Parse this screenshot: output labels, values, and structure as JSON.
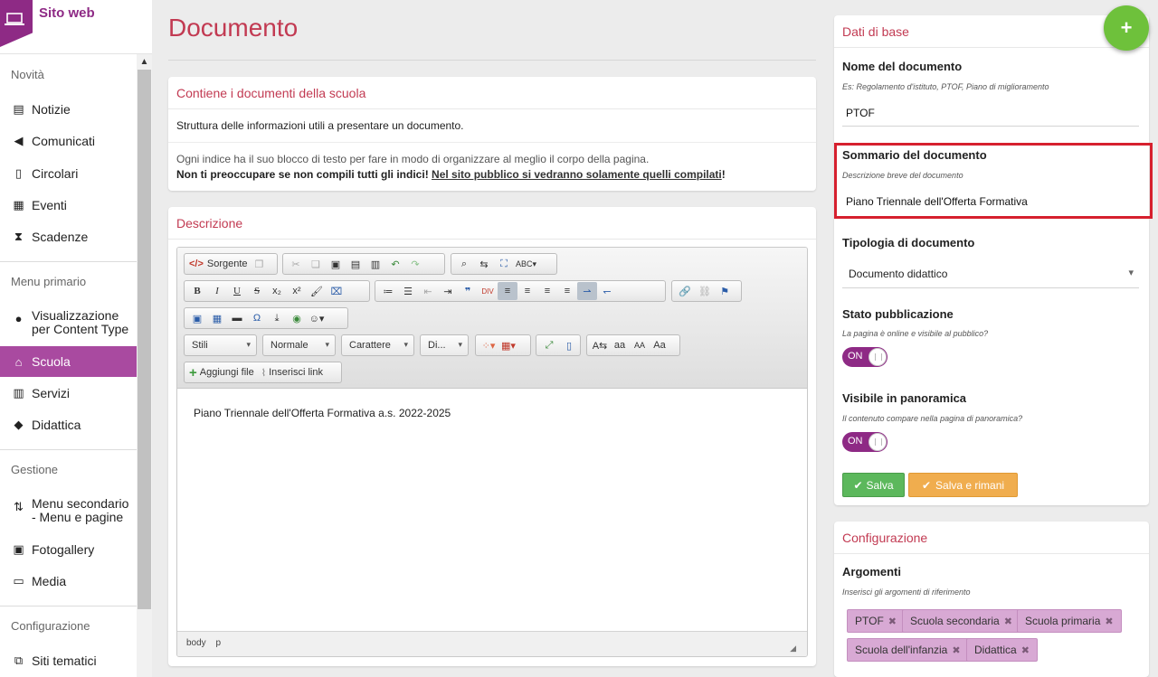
{
  "brand": {
    "title": "Sito web"
  },
  "sidebar": {
    "sections": [
      "Novità",
      "Menu primario",
      "Gestione",
      "Configurazione"
    ],
    "items": [
      {
        "label": "Notizie"
      },
      {
        "label": "Comunicati"
      },
      {
        "label": "Circolari"
      },
      {
        "label": "Eventi"
      },
      {
        "label": "Scadenze"
      },
      {
        "label": "Visualizzazione per Content Type"
      },
      {
        "label": "Scuola"
      },
      {
        "label": "Servizi"
      },
      {
        "label": "Didattica"
      },
      {
        "label": "Menu secondario - Menu e pagine"
      },
      {
        "label": "Fotogallery"
      },
      {
        "label": "Media"
      },
      {
        "label": "Siti tematici"
      }
    ]
  },
  "main": {
    "title": "Documento",
    "info_panel": {
      "heading": "Contiene i documenti della scuola",
      "line1": "Struttura delle informazioni utili a presentare un documento.",
      "line2": "Ogni indice ha il suo blocco di testo per fare in modo di organizzare al meglio il corpo della pagina.",
      "line3_bold": "Non ti preoccupare se non compili tutti gli indici!",
      "line3_underline": "Nel sito pubblico si vedranno solamente quelli compilati",
      "line3_end": "!"
    },
    "description_panel": {
      "heading": "Descrizione",
      "editor": {
        "source_label": "Sorgente",
        "styles": "Stili",
        "format": "Normale",
        "font": "Carattere",
        "size": "Di...",
        "add_file": "Aggiungi file",
        "insert_link": "Inserisci link",
        "content": "Piano Triennale dell'Offerta Formativa a.s. 2022-2025",
        "path": [
          "body",
          "p"
        ]
      }
    }
  },
  "right": {
    "basic": {
      "heading": "Dati di base",
      "name_label": "Nome del documento",
      "name_help": "Es: Regolamento d'istituto, PTOF, Piano di miglioramento",
      "name_value": "PTOF",
      "summary_label": "Sommario del documento",
      "summary_help": "Descrizione breve del documento",
      "summary_value": "Piano Triennale dell'Offerta Formativa",
      "type_label": "Tipologia di documento",
      "type_value": "Documento didattico",
      "status_label": "Stato pubblicazione",
      "status_help": "La pagina è online e visibile al pubblico?",
      "status_toggle": "ON",
      "overview_label": "Visibile in panoramica",
      "overview_help": "Il contenuto compare nella pagina di panoramica?",
      "overview_toggle": "ON",
      "save": "Salva",
      "save_stay": "Salva e rimani"
    },
    "config": {
      "heading": "Configurazione",
      "topics_label": "Argomenti",
      "topics_help": "Inserisci gli argomenti di riferimento",
      "tags": [
        "PTOF",
        "Scuola secondaria",
        "Scuola primaria",
        "Scuola dell'infanzia",
        "Didattica"
      ]
    },
    "fab": "+"
  },
  "colors": {
    "accent": "#8e2a85",
    "title": "#c23a52",
    "save": "#5cb85c",
    "save_stay": "#f0ad4e",
    "highlight": "#d6202e",
    "fab": "#6ec13b"
  }
}
